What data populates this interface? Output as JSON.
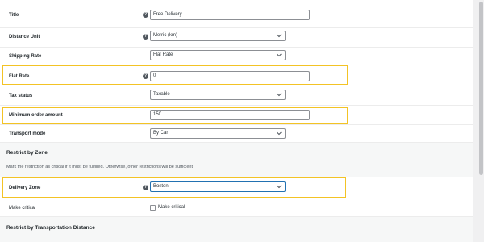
{
  "fields": {
    "title": {
      "label": "Title",
      "value": "Free Delivery"
    },
    "distance_unit": {
      "label": "Distance Unit",
      "value": "Metric (km)"
    },
    "shipping_rate": {
      "label": "Shipping Rate",
      "value": "Flat Rate"
    },
    "flat_rate": {
      "label": "Flat Rate",
      "value": "0"
    },
    "tax_status": {
      "label": "Tax status",
      "value": "Taxable"
    },
    "min_order": {
      "label": "Minimum order amount",
      "value": "150"
    },
    "transport_mode": {
      "label": "Transport mode",
      "value": "By Car"
    }
  },
  "zone_section": {
    "title": "Restrict by Zone",
    "description": "Mark the restriction as critical if it must be fulfilled. Otherwise, other restrictions will be sufficient",
    "delivery_zone": {
      "label": "Delivery Zone",
      "value": "Boston"
    },
    "make_critical": {
      "label": "Make critical",
      "checkbox_label": "Make critical",
      "checked": false
    }
  },
  "distance_section": {
    "title": "Restrict by Transportation Distance"
  },
  "help_icon_glyph": "?",
  "colors": {
    "highlight": "#f3c325",
    "focus_border": "#2271b1",
    "section_bg": "#f6f7f7"
  }
}
